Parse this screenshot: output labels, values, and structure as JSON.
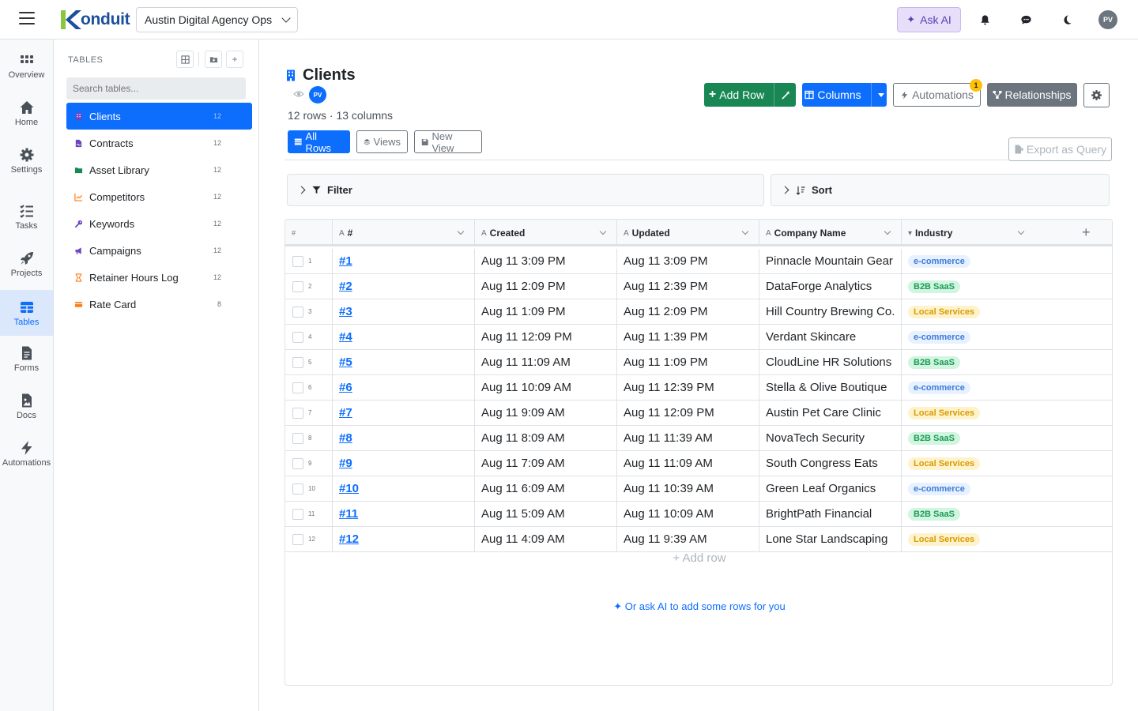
{
  "app": {
    "logo_text": "onduit",
    "workspace": "Austin Digital Agency Ops",
    "ask_ai": "Ask AI",
    "avatar_initials": "PV",
    "brand_color": "#1b4f9c",
    "accent_color": "#0d6efd"
  },
  "nav": [
    {
      "label": "Overview",
      "icon": "grid-dots-icon"
    },
    {
      "label": "Home",
      "icon": "home-icon"
    },
    {
      "label": "Settings",
      "icon": "gear-icon"
    },
    {
      "label": "Tasks",
      "icon": "tasks-icon"
    },
    {
      "label": "Projects",
      "icon": "rocket-icon"
    },
    {
      "label": "Tables",
      "icon": "table-icon"
    },
    {
      "label": "Forms",
      "icon": "form-icon"
    },
    {
      "label": "Docs",
      "icon": "doc-icon"
    },
    {
      "label": "Automations",
      "icon": "bolt-icon"
    }
  ],
  "tables_panel": {
    "heading": "TABLES",
    "search_placeholder": "Search tables...",
    "items": [
      {
        "name": "Clients",
        "count": "12",
        "icon": "building-icon",
        "color": "#6f42c1"
      },
      {
        "name": "Contracts",
        "count": "12",
        "icon": "signature-icon",
        "color": "#6f42c1"
      },
      {
        "name": "Asset Library",
        "count": "12",
        "icon": "folder-icon",
        "color": "#198754"
      },
      {
        "name": "Competitors",
        "count": "12",
        "icon": "chart-line-icon",
        "color": "#fd7e14"
      },
      {
        "name": "Keywords",
        "count": "12",
        "icon": "key-icon",
        "color": "#6f42c1"
      },
      {
        "name": "Campaigns",
        "count": "12",
        "icon": "megaphone-icon",
        "color": "#6f42c1"
      },
      {
        "name": "Retainer Hours Log",
        "count": "12",
        "icon": "hourglass-icon",
        "color": "#fd7e14"
      },
      {
        "name": "Rate Card",
        "count": "8",
        "icon": "card-icon",
        "color": "#fd7e14"
      }
    ]
  },
  "main": {
    "title": "Clients",
    "owner_initials": "PV",
    "row_summary": "12 rows · 13 columns",
    "buttons": {
      "add_row": "Add Row",
      "columns": "Columns",
      "automations": "Automations",
      "automations_badge": "1",
      "relationships": "Relationships",
      "export": "Export as Query"
    },
    "views": {
      "all_rows": "All Rows",
      "views": "Views",
      "new_view": "New View"
    },
    "filter_label": "Filter",
    "sort_label": "Sort",
    "add_row_label": "Add row",
    "ask_ai_rows": "Or ask AI to add some rows for you"
  },
  "grid": {
    "columns": [
      {
        "label": "#"
      },
      {
        "label": "#",
        "type_icon": "A"
      },
      {
        "label": "Created",
        "type_icon": "A"
      },
      {
        "label": "Updated",
        "type_icon": "A"
      },
      {
        "label": "Company Name",
        "type_icon": "A"
      },
      {
        "label": "Industry",
        "type_icon": "▾"
      }
    ],
    "rows": [
      {
        "n": "1",
        "id": "#1",
        "created": "Aug 11 3:09 PM",
        "updated": "Aug 11 3:09 PM",
        "company": "Pinnacle Mountain Gear",
        "industry": "e-commerce",
        "tag": "ecom"
      },
      {
        "n": "2",
        "id": "#2",
        "created": "Aug 11 2:09 PM",
        "updated": "Aug 11 2:39 PM",
        "company": "DataForge Analytics",
        "industry": "B2B SaaS",
        "tag": "b2b"
      },
      {
        "n": "3",
        "id": "#3",
        "created": "Aug 11 1:09 PM",
        "updated": "Aug 11 2:09 PM",
        "company": "Hill Country Brewing Co.",
        "industry": "Local Services",
        "tag": "local"
      },
      {
        "n": "4",
        "id": "#4",
        "created": "Aug 11 12:09 PM",
        "updated": "Aug 11 1:39 PM",
        "company": "Verdant Skincare",
        "industry": "e-commerce",
        "tag": "ecom"
      },
      {
        "n": "5",
        "id": "#5",
        "created": "Aug 11 11:09 AM",
        "updated": "Aug 11 1:09 PM",
        "company": "CloudLine HR Solutions",
        "industry": "B2B SaaS",
        "tag": "b2b"
      },
      {
        "n": "6",
        "id": "#6",
        "created": "Aug 11 10:09 AM",
        "updated": "Aug 11 12:39 PM",
        "company": "Stella & Olive Boutique",
        "industry": "e-commerce",
        "tag": "ecom"
      },
      {
        "n": "7",
        "id": "#7",
        "created": "Aug 11 9:09 AM",
        "updated": "Aug 11 12:09 PM",
        "company": "Austin Pet Care Clinic",
        "industry": "Local Services",
        "tag": "local"
      },
      {
        "n": "8",
        "id": "#8",
        "created": "Aug 11 8:09 AM",
        "updated": "Aug 11 11:39 AM",
        "company": "NovaTech Security",
        "industry": "B2B SaaS",
        "tag": "b2b"
      },
      {
        "n": "9",
        "id": "#9",
        "created": "Aug 11 7:09 AM",
        "updated": "Aug 11 11:09 AM",
        "company": "South Congress Eats",
        "industry": "Local Services",
        "tag": "local"
      },
      {
        "n": "10",
        "id": "#10",
        "created": "Aug 11 6:09 AM",
        "updated": "Aug 11 10:39 AM",
        "company": "Green Leaf Organics",
        "industry": "e-commerce",
        "tag": "ecom"
      },
      {
        "n": "11",
        "id": "#11",
        "created": "Aug 11 5:09 AM",
        "updated": "Aug 11 10:09 AM",
        "company": "BrightPath Financial",
        "industry": "B2B SaaS",
        "tag": "b2b"
      },
      {
        "n": "12",
        "id": "#12",
        "created": "Aug 11 4:09 AM",
        "updated": "Aug 11 9:39 AM",
        "company": "Lone Star Landscaping",
        "industry": "Local Services",
        "tag": "local"
      }
    ]
  }
}
